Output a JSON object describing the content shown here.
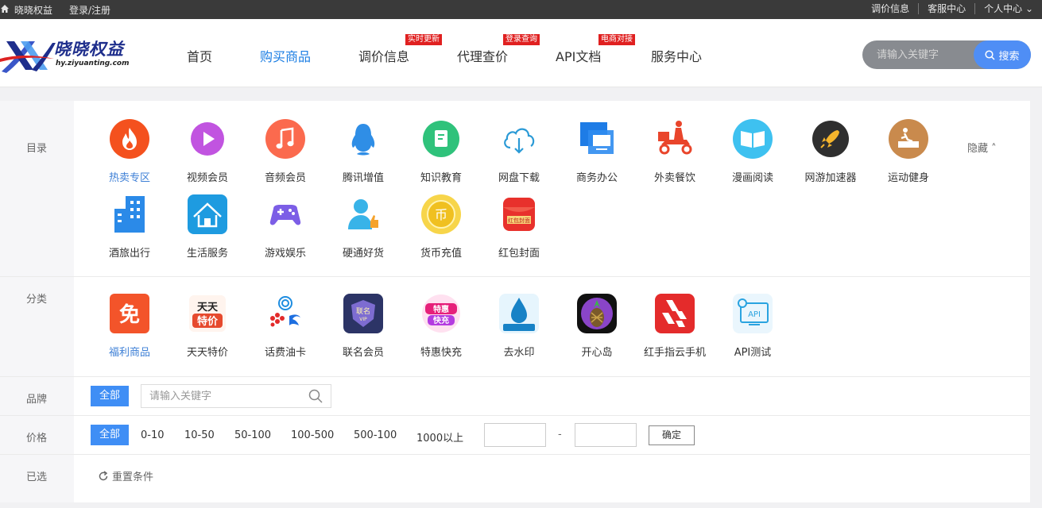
{
  "topbar": {
    "site_name": "晓晓权益",
    "login": "登录/注册",
    "links": [
      "调价信息",
      "客服中心",
      "个人中心 ⌄"
    ]
  },
  "logo": {
    "title": "晓晓权益",
    "url": "hy.ziyuanting.com"
  },
  "nav": {
    "items": [
      {
        "label": "首页"
      },
      {
        "label": "购买商品",
        "active": true
      },
      {
        "label": "调价信息",
        "badge": "实时更新"
      },
      {
        "label": "代理查价",
        "badge": "登录查询"
      },
      {
        "label": "API文档",
        "badge": "电商对接"
      },
      {
        "label": "服务中心"
      }
    ]
  },
  "search": {
    "placeholder": "请输入关键字",
    "button": "搜索"
  },
  "filters": {
    "catalog_label": "目录",
    "catalog_items": [
      "热卖专区",
      "视频会员",
      "音频会员",
      "腾讯增值",
      "知识教育",
      "网盘下载",
      "商务办公",
      "外卖餐饮",
      "漫画阅读",
      "网游加速器",
      "运动健身",
      "酒旅出行",
      "生活服务",
      "游戏娱乐",
      "硬通好货",
      "货币充值",
      "红包封面"
    ],
    "hide": "隐藏 ˄",
    "category_label": "分类",
    "category_items": [
      "福利商品",
      "天天特价",
      "话费油卡",
      "联名会员",
      "特惠快充",
      "去水印",
      "开心岛",
      "红手指云手机",
      "API测试"
    ],
    "brand_label": "品牌",
    "all": "全部",
    "brand_placeholder": "请输入关键字",
    "price_label": "价格",
    "price_options": [
      "0-10",
      "10-50",
      "50-100",
      "100-500",
      "500-100",
      "1000以上"
    ],
    "price_dash": "-",
    "confirm": "确定",
    "selected_label": "已选",
    "reset": "重置条件"
  },
  "icon_glyphs": {
    "tiantian_top": "天天",
    "tiantian_bottom": "特价",
    "mian": "免",
    "lianming_top": "联名",
    "lianming_bottom": "VIP",
    "tehui_top": "特惠",
    "tehui_bottom": "快充",
    "hongbao": "红包封面",
    "coin": "币",
    "api": "API"
  },
  "colors": {
    "accent": "#3f8ef5",
    "nav_active": "#1a7de3",
    "badge": "#e02020",
    "topbar": "#3a3a3a"
  }
}
